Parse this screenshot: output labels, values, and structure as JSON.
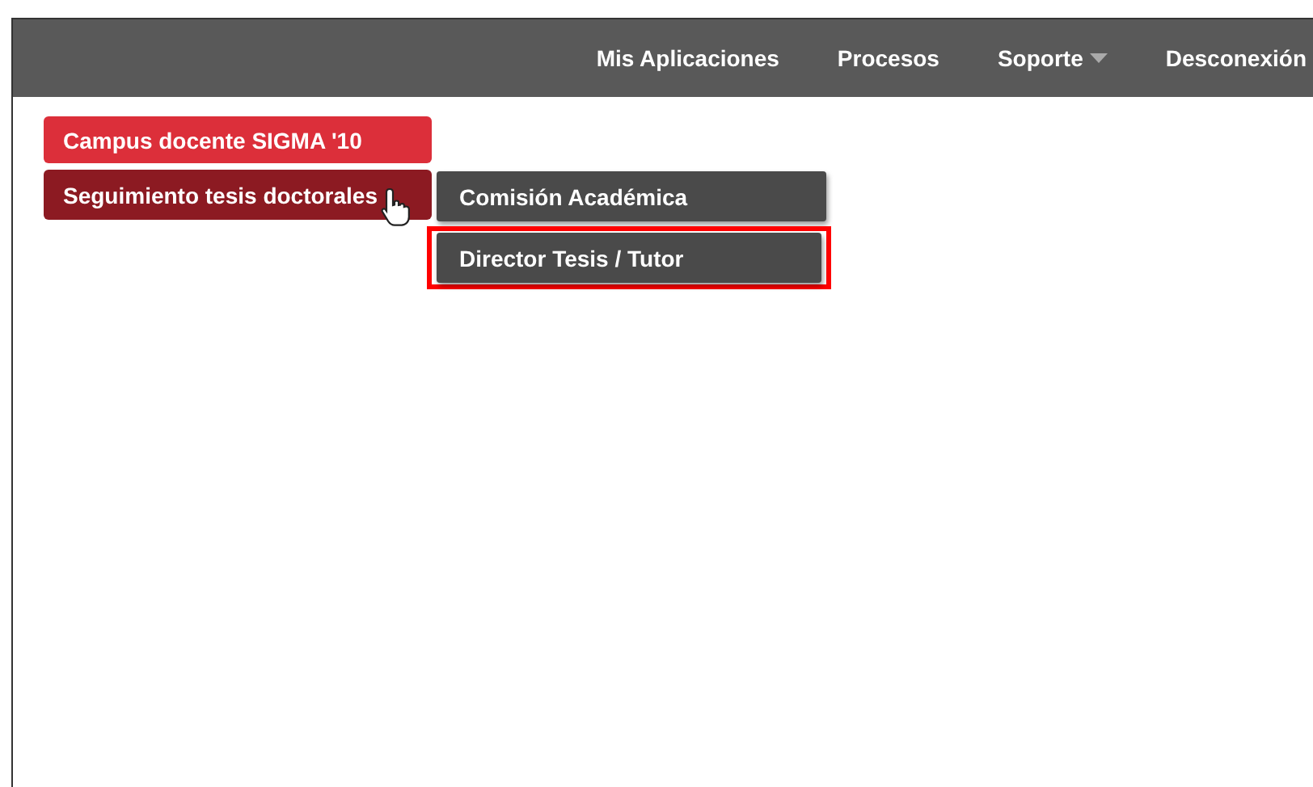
{
  "nav": [
    {
      "label": "Mis Aplicaciones",
      "dropdown": false
    },
    {
      "label": "Procesos",
      "dropdown": false
    },
    {
      "label": "Soporte",
      "dropdown": true
    },
    {
      "label": "Desconexión",
      "dropdown": false
    }
  ],
  "menu": [
    {
      "label": "Campus docente SIGMA '10",
      "selected": false,
      "submenu": false
    },
    {
      "label": "Seguimiento tesis doctorales",
      "selected": true,
      "submenu": true
    }
  ],
  "submenu": [
    {
      "label": "Comisión Académica",
      "highlighted": false
    },
    {
      "label": "Director Tesis / Tutor",
      "highlighted": true
    }
  ]
}
